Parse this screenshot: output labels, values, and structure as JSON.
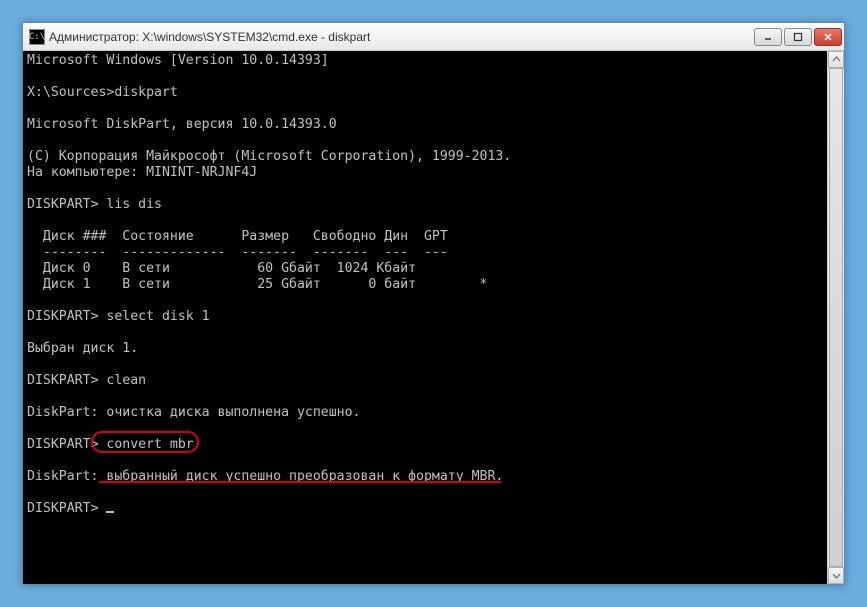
{
  "window": {
    "title": "Администратор: X:\\windows\\SYSTEM32\\cmd.exe - diskpart",
    "icon_label": "C:\\"
  },
  "terminal": {
    "lines": [
      "Microsoft Windows [Version 10.0.14393]",
      "",
      "X:\\Sources>diskpart",
      "",
      "Microsoft DiskPart, версия 10.0.14393.0",
      "",
      "(С) Корпорация Майкрософт (Microsoft Corporation), 1999-2013.",
      "На компьютере: MININT-NRJNF4J",
      "",
      "DISKPART> lis dis",
      "",
      "  Диск ###  Состояние      Размер   Свободно Дин  GPT",
      "  --------  -------------  -------  -------  ---  ---",
      "  Диск 0    В сети           60 Gбайт  1024 Kбайт",
      "  Диск 1    В сети           25 Gбайт      0 байт        *",
      "",
      "DISKPART> select disk 1",
      "",
      "Выбран диск 1.",
      "",
      "DISKPART> clean",
      "",
      "DiskPart: очистка диска выполнена успешно.",
      "",
      "DISKPART> convert mbr",
      "",
      "DiskPart: выбранный диск успешно преобразован к формату MBR.",
      "",
      "DISKPART> "
    ]
  },
  "annotations": {
    "highlight_command": "convert mbr",
    "underline_text": "выбранный диск успешно преобразован к формату MBR."
  }
}
